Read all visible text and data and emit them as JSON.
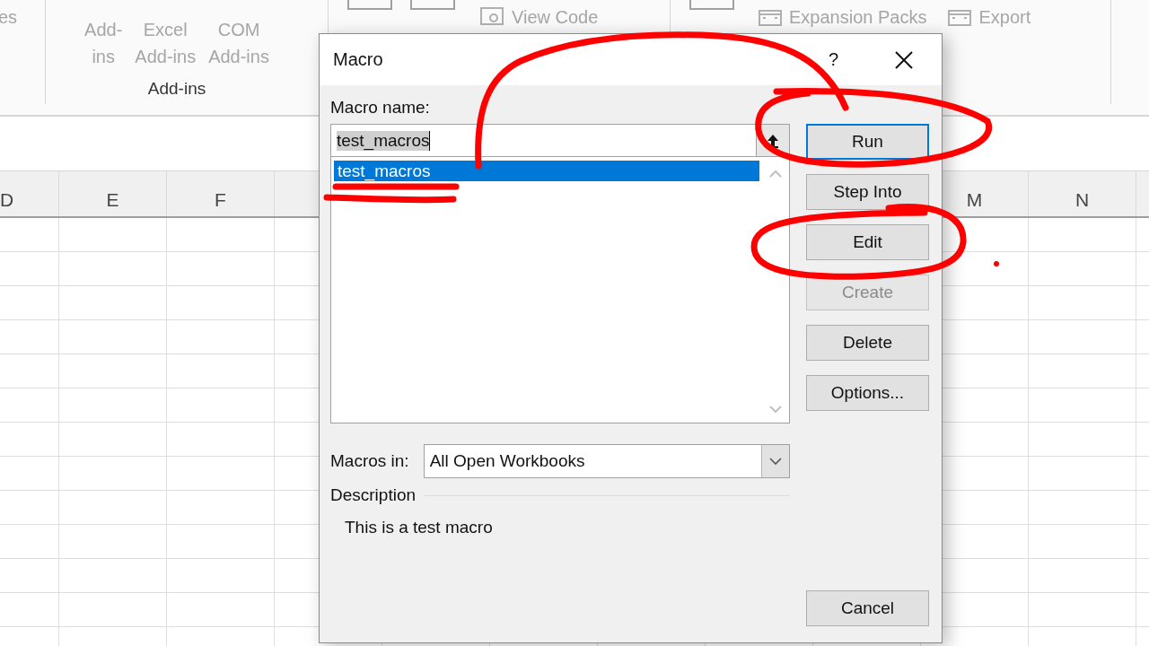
{
  "ribbon": {
    "left_fragment": "es",
    "addins_group": {
      "label": "Add-ins",
      "buttons": [
        {
          "lines": [
            "Add-",
            "ins"
          ]
        },
        {
          "lines": [
            "Excel",
            "Add-ins"
          ]
        },
        {
          "lines": [
            "COM",
            "Add-ins"
          ]
        }
      ]
    },
    "controls_group": [
      {
        "kind": "large"
      },
      {
        "kind": "large"
      },
      {
        "kind": "small",
        "label": "View Code"
      }
    ],
    "xml_group": [
      {
        "kind": "large"
      },
      {
        "kind": "small",
        "label": "Expansion Packs"
      },
      {
        "kind": "small",
        "label": "Export"
      }
    ]
  },
  "sheet": {
    "columns": [
      {
        "label": "D"
      },
      {
        "label": "E"
      },
      {
        "label": "F"
      },
      {},
      {},
      {},
      {},
      {},
      {},
      {
        "label": "M"
      },
      {
        "label": "N"
      },
      {}
    ]
  },
  "dialog": {
    "title": "Macro",
    "help": "?",
    "macro_name": {
      "label": "Macro name:",
      "value": "test_macros"
    },
    "macros": [
      {
        "name": "test_macros",
        "selected": true
      }
    ],
    "buttons": [
      {
        "label": "Run",
        "default": true,
        "disabled": false
      },
      {
        "label": "Step Into",
        "default": false,
        "disabled": false
      },
      {
        "label": "Edit",
        "default": false,
        "disabled": false
      },
      {
        "label": "Create",
        "default": false,
        "disabled": true
      },
      {
        "label": "Delete",
        "default": false,
        "disabled": false
      },
      {
        "label": "Options...",
        "default": false,
        "disabled": false
      }
    ],
    "macros_in": {
      "label": "Macros in:",
      "value": "All Open Workbooks"
    },
    "description": {
      "label": "Description",
      "text": "This is a test macro"
    },
    "cancel": "Cancel"
  }
}
